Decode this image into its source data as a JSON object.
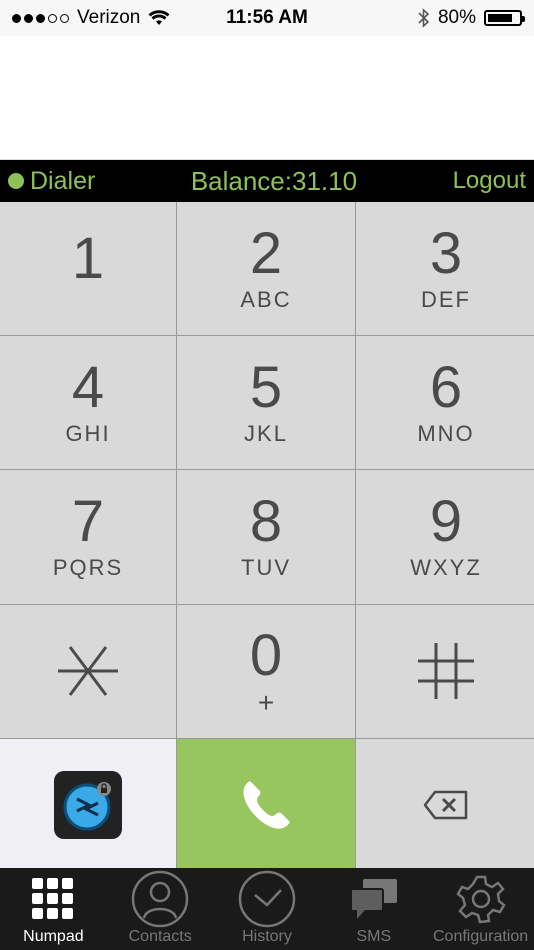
{
  "status_bar": {
    "carrier": "Verizon",
    "time": "11:56 AM",
    "battery_percent": "80%",
    "battery_level": 0.8,
    "signal_bars": 3,
    "signal_total": 5
  },
  "header": {
    "title": "Dialer",
    "balance": "Balance:31.10",
    "logout_label": "Logout",
    "accent_color": "#8dc15a"
  },
  "keypad": {
    "keys": [
      {
        "num": "1",
        "letters": ""
      },
      {
        "num": "2",
        "letters": "ABC"
      },
      {
        "num": "3",
        "letters": "DEF"
      },
      {
        "num": "4",
        "letters": "GHI"
      },
      {
        "num": "5",
        "letters": "JKL"
      },
      {
        "num": "6",
        "letters": "MNO"
      },
      {
        "num": "7",
        "letters": "PQRS"
      },
      {
        "num": "8",
        "letters": "TUV"
      },
      {
        "num": "9",
        "letters": "WXYZ"
      },
      {
        "num": "*",
        "letters": ""
      },
      {
        "num": "0",
        "letters": "+"
      },
      {
        "num": "#",
        "letters": ""
      }
    ],
    "call_color": "#96c65d"
  },
  "tabbar": {
    "tabs": [
      {
        "label": "Numpad",
        "icon": "grid-icon",
        "active": true
      },
      {
        "label": "Contacts",
        "icon": "person-icon",
        "active": false
      },
      {
        "label": "History",
        "icon": "clock-icon",
        "active": false
      },
      {
        "label": "SMS",
        "icon": "chat-icon",
        "active": false
      },
      {
        "label": "Configuration",
        "icon": "gear-icon",
        "active": false
      }
    ]
  }
}
